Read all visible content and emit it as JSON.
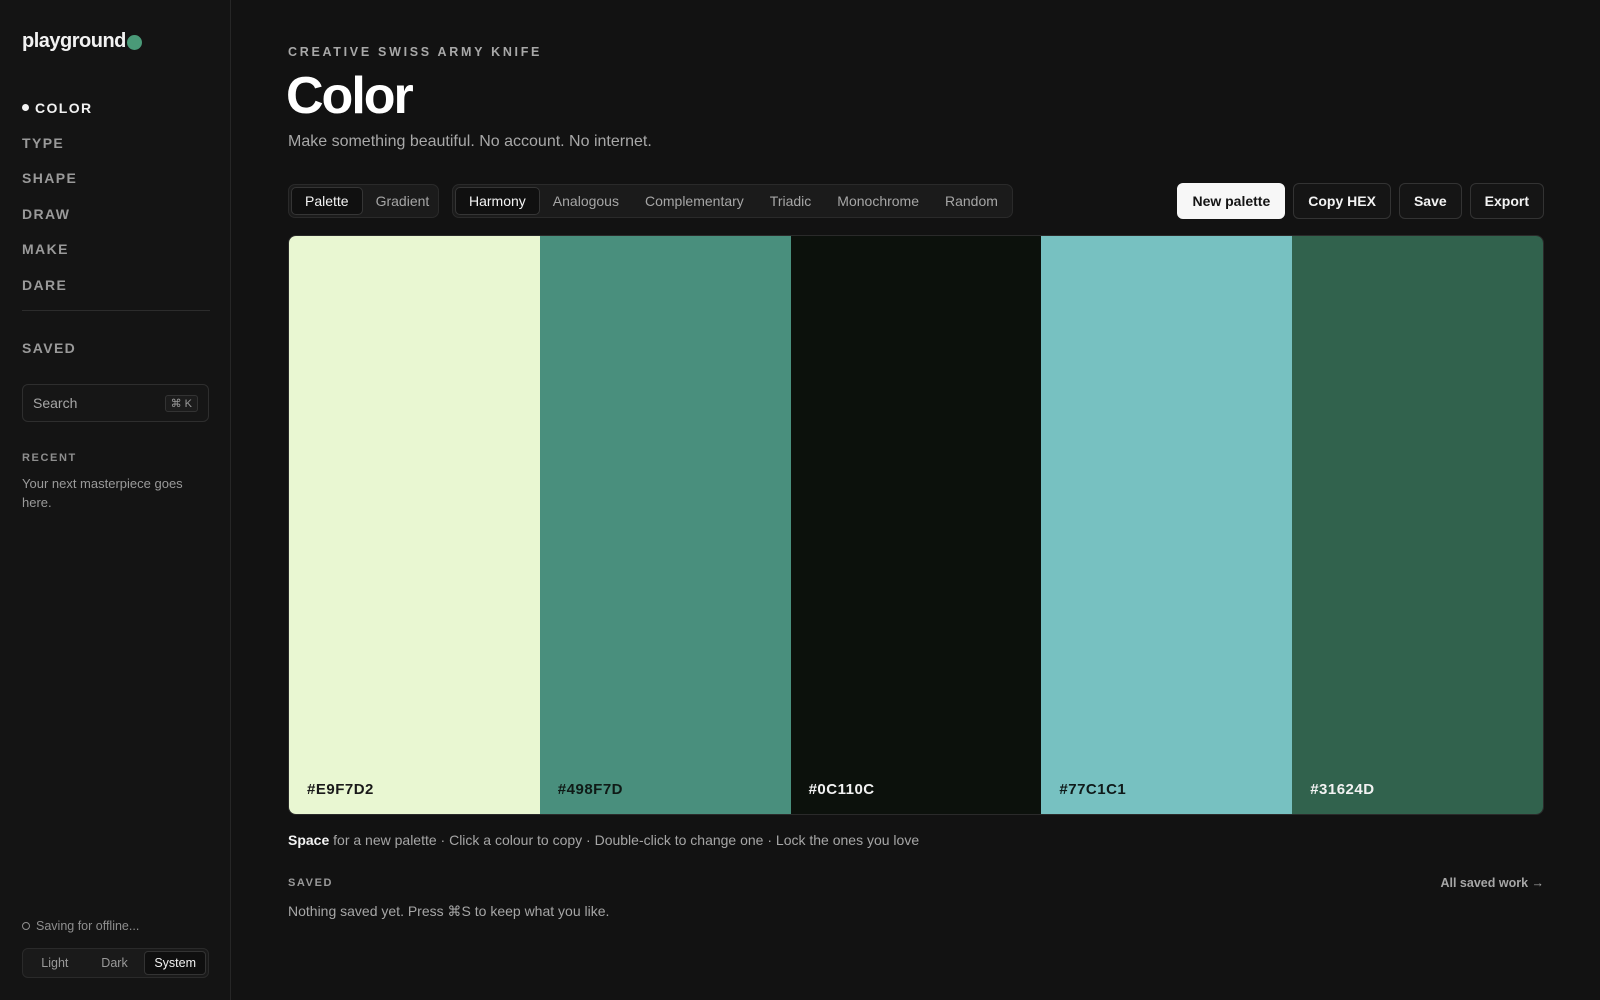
{
  "sidebar": {
    "logo": "playground",
    "logo_dot_color": "#4a9a78",
    "nav": [
      "COLOR",
      "TYPE",
      "SHAPE",
      "DRAW",
      "MAKE",
      "DARE"
    ],
    "active_nav": "COLOR",
    "saved_label": "SAVED",
    "search": {
      "placeholder": "Search",
      "shortcut": "⌘ K"
    },
    "recent": {
      "heading": "RECENT",
      "empty_text": "Your next masterpiece goes here."
    },
    "offline_status": "Saving for offline...",
    "theme": {
      "options": [
        "Light",
        "Dark",
        "System"
      ],
      "active": "System"
    }
  },
  "header": {
    "eyebrow": "CREATIVE SWISS ARMY KNIFE",
    "title": "Color",
    "subtitle": "Make something beautiful. No account. No internet."
  },
  "mode_tabs": {
    "options": [
      "Palette",
      "Gradient"
    ],
    "active": "Palette"
  },
  "harmony_tabs": {
    "options": [
      "Harmony",
      "Analogous",
      "Complementary",
      "Triadic",
      "Monochrome",
      "Random"
    ],
    "active": "Harmony"
  },
  "actions": {
    "new_palette": "New palette",
    "copy_hex": "Copy HEX",
    "save": "Save",
    "export": "Export"
  },
  "palette": {
    "swatches": [
      {
        "hex": "#E9F7D2",
        "color": "#E9F7D2",
        "text_color": "#1a1a1a"
      },
      {
        "hex": "#498F7D",
        "color": "#498F7D",
        "text_color": "#0f1a16"
      },
      {
        "hex": "#0C110C",
        "color": "#0C110C",
        "text_color": "#f2f2f2"
      },
      {
        "hex": "#77C1C1",
        "color": "#77C1C1",
        "text_color": "#0f1a1a"
      },
      {
        "hex": "#31624D",
        "color": "#31624D",
        "text_color": "#f2f2f2"
      }
    ]
  },
  "hint": {
    "key": "Space",
    "text": " for a new palette · Click a colour to copy · Double-click to change one · Lock the ones you love"
  },
  "saved_section": {
    "heading": "SAVED",
    "link": "All saved work →",
    "empty_text": "Nothing saved yet. Press ⌘S to keep what you like."
  }
}
